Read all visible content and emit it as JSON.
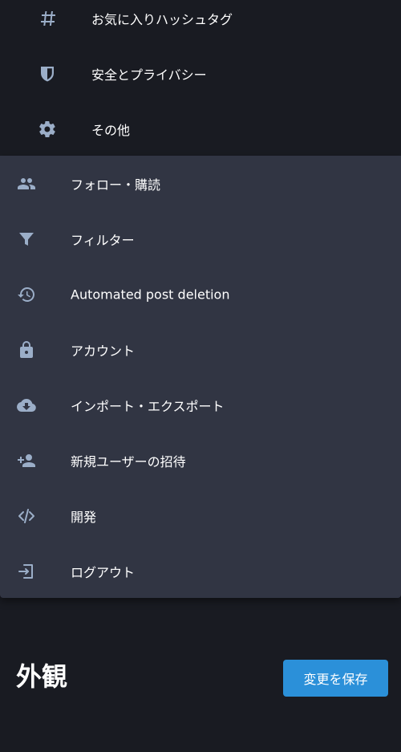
{
  "nav": {
    "items": [
      {
        "label": "お気に入りハッシュタグ",
        "icon": "hashtag-icon"
      },
      {
        "label": "安全とプライバシー",
        "icon": "shield-icon"
      },
      {
        "label": "その他",
        "icon": "gear-icon"
      }
    ]
  },
  "dropdown": {
    "items": [
      {
        "label": "フォロー・購読",
        "icon": "users-icon"
      },
      {
        "label": "フィルター",
        "icon": "filter-icon"
      },
      {
        "label": "Automated post deletion",
        "icon": "history-icon"
      },
      {
        "label": "アカウント",
        "icon": "lock-icon"
      },
      {
        "label": "インポート・エクスポート",
        "icon": "cloud-download-icon"
      },
      {
        "label": "新規ユーザーの招待",
        "icon": "user-plus-icon"
      },
      {
        "label": "開発",
        "icon": "code-icon"
      },
      {
        "label": "ログアウト",
        "icon": "sign-out-icon"
      }
    ]
  },
  "main": {
    "title": "外観",
    "save_label": "変更を保存"
  },
  "colors": {
    "background": "#191b22",
    "dropdown_background": "#313543",
    "icon": "#9baec8",
    "accent": "#2b90d9",
    "text": "#ffffff"
  }
}
